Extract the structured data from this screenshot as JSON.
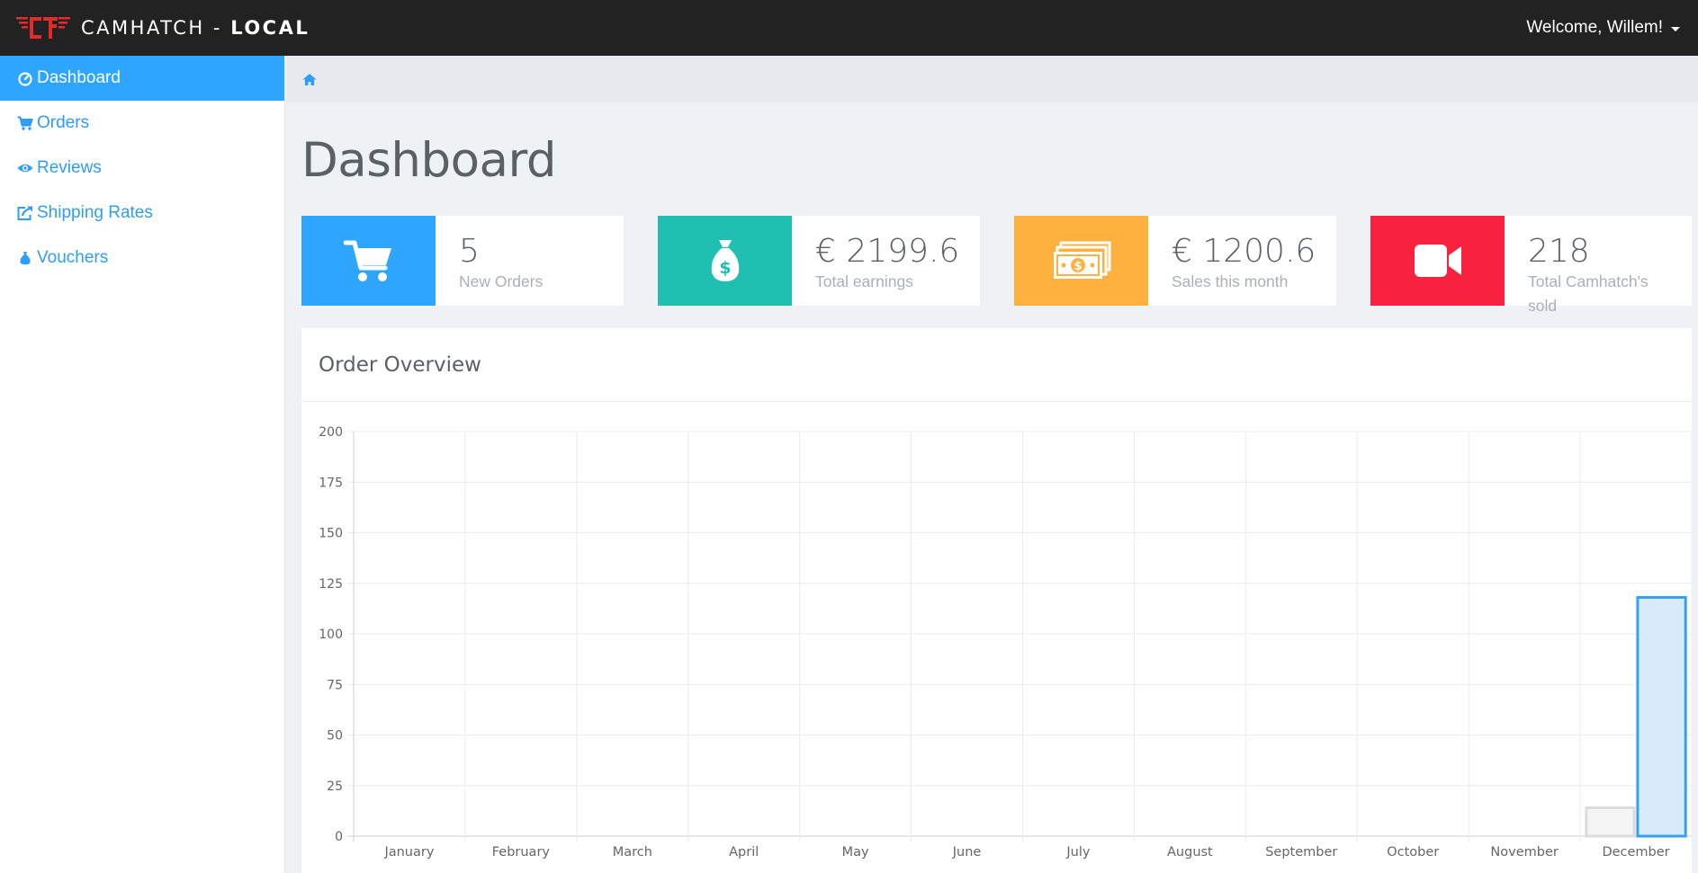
{
  "header": {
    "brand_name": "CAMHATCH",
    "brand_separator": "-",
    "brand_env": "LOCAL",
    "welcome": "Welcome, Willem!"
  },
  "sidebar": {
    "items": [
      {
        "label": "Dashboard",
        "icon": "dashboard-icon",
        "active": true
      },
      {
        "label": "Orders",
        "icon": "shopping-cart-icon",
        "active": false
      },
      {
        "label": "Reviews",
        "icon": "eye-icon",
        "active": false
      },
      {
        "label": "Shipping Rates",
        "icon": "share-icon",
        "active": false
      },
      {
        "label": "Vouchers",
        "icon": "money-bag-icon",
        "active": false
      }
    ]
  },
  "breadcrumb": {
    "icon": "home-icon"
  },
  "page": {
    "title": "Dashboard"
  },
  "stats": [
    {
      "value": "5",
      "label": "New Orders",
      "icon": "shopping-cart-icon",
      "color": "#2ea6ff"
    },
    {
      "value": "€ 2199.6",
      "label": "Total earnings",
      "icon": "money-bag-icon",
      "color": "#1fbfb1"
    },
    {
      "value": "€ 1200.6",
      "label": "Sales this month",
      "icon": "money-stack-icon",
      "color": "#ffb13f"
    },
    {
      "value": "218",
      "label": "Total Camhatch's sold",
      "icon": "video-camera-icon",
      "color": "#f8213f"
    }
  ],
  "panel": {
    "title": "Order Overview"
  },
  "chart_data": {
    "type": "bar",
    "categories": [
      "January",
      "February",
      "March",
      "April",
      "May",
      "June",
      "July",
      "August",
      "September",
      "October",
      "November",
      "December"
    ],
    "series": [
      {
        "values": [
          0,
          0,
          0,
          0,
          0,
          0,
          0,
          0,
          0,
          0,
          0,
          14
        ],
        "color": "#dcdcdc",
        "fill": "#f5f5f5"
      },
      {
        "values": [
          0,
          0,
          0,
          0,
          0,
          0,
          0,
          0,
          0,
          0,
          0,
          118
        ],
        "color": "#36a2eb",
        "fill": "#d7ebfb"
      }
    ],
    "y_ticks": [
      0,
      25,
      50,
      75,
      100,
      125,
      150,
      175,
      200
    ],
    "ylim": [
      0,
      200
    ],
    "grid": true
  },
  "colors": {
    "accent": "#2ea6ff",
    "topbar": "#222222",
    "logo": "#e52a2a"
  }
}
